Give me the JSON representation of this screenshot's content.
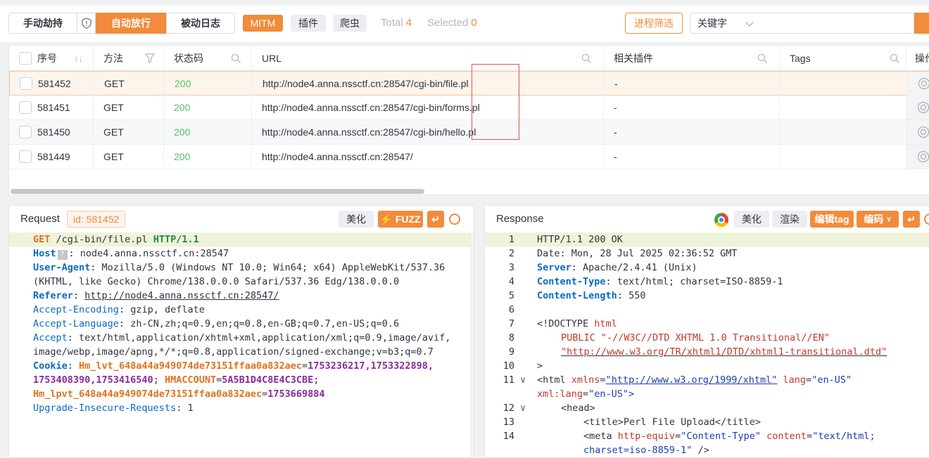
{
  "topbar": {
    "mode_manual": "手动劫持",
    "mode_auto": "自动放行",
    "mode_passive": "被动日志",
    "chip_mitm": "MITM",
    "chip_plugin": "插件",
    "chip_crawler": "爬虫",
    "total_label": "Total",
    "total_value": "4",
    "selected_label": "Selected",
    "selected_value": "0",
    "process_filter": "进程筛选",
    "keyword_select": "关键字",
    "search_placeholder": ""
  },
  "table": {
    "headers": {
      "seq": "序号",
      "method": "方法",
      "status": "状态码",
      "url": "URL",
      "plugins": "相关插件",
      "tags": "Tags",
      "ops": "操作"
    },
    "rows": [
      {
        "id": "581452",
        "method": "GET",
        "status": "200",
        "url": "http://node4.anna.nssctf.cn:28547/cgi-bin/file.pl",
        "plugins": "-",
        "tags": ""
      },
      {
        "id": "581451",
        "method": "GET",
        "status": "200",
        "url": "http://node4.anna.nssctf.cn:28547/cgi-bin/forms.pl",
        "plugins": "-",
        "tags": ""
      },
      {
        "id": "581450",
        "method": "GET",
        "status": "200",
        "url": "http://node4.anna.nssctf.cn:28547/cgi-bin/hello.pl",
        "plugins": "-",
        "tags": ""
      },
      {
        "id": "581449",
        "method": "GET",
        "status": "200",
        "url": "http://node4.anna.nssctf.cn:28547/",
        "plugins": "-",
        "tags": ""
      }
    ]
  },
  "request": {
    "title": "Request",
    "id_label": "id:",
    "id_value": "581452",
    "beautify": "美化",
    "fuzz": "FUZZ",
    "method": "GET",
    "path": "/cgi-bin/file.pl",
    "protocol": "HTTP/1.1",
    "host_key": "Host",
    "host_value": "node4.anna.nssctf.cn:28547",
    "ua_key": "User-Agent",
    "ua_value_1": "Mozilla/5.0 (Windows NT 10.0; Win64; x64) AppleWebKit/537.36",
    "ua_value_2": "(KHTML, like Gecko) Chrome/138.0.0.0 Safari/537.36 Edg/138.0.0.0",
    "referer_key": "Referer",
    "referer_value": "http://node4.anna.nssctf.cn:28547/",
    "ae_key": "Accept-Encoding",
    "ae_value": "gzip, deflate",
    "al_key": "Accept-Language",
    "al_value": "zh-CN,zh;q=0.9,en;q=0.8,en-GB;q=0.7,en-US;q=0.6",
    "accept_key": "Accept",
    "accept_value_1": "text/html,application/xhtml+xml,application/xml;q=0.9,image/avif,",
    "accept_value_2": "image/webp,image/apng,*/*;q=0.8,application/signed-exchange;v=b3;q=0.7",
    "cookie_key": "Cookie",
    "cookie_1_key": "Hm_lvt_648a44a949074de73151ffaa0a832aec",
    "cookie_1_val_a": "1753236217,1753322898,",
    "cookie_1_val_b": "1753408390,1753416540",
    "cookie_2_key": "HMACCOUNT",
    "cookie_2_val": "5A5B1D4C8E4C3CBE",
    "cookie_3_key": "Hm_lpvt_648a44a949074de73151ffaa0a832aec",
    "cookie_3_val": "1753669884",
    "uir_key": "Upgrade-Insecure-Requests",
    "uir_value": "1"
  },
  "response": {
    "title": "Response",
    "beautify": "美化",
    "render": "渲染",
    "edit_tag": "编辑tag",
    "encode": "编码",
    "status_line": "HTTP/1.1 200 OK",
    "date_line": "Date: Mon, 28 Jul 2025 02:36:52 GMT",
    "server_key": "Server",
    "server_value": "Apache/2.4.41 (Unix)",
    "ct_key": "Content-Type",
    "ct_value": "text/html; charset=ISO-8859-1",
    "cl_key": "Content-Length",
    "cl_value": "550",
    "doctype_1": "<!DOCTYPE",
    "doctype_html": "html",
    "doctype_2": "PUBLIC \"-//W3C//DTD XHTML 1.0 Transitional//EN\"",
    "doctype_3": "\"http://www.w3.org/TR/xhtml1/DTD/xhtml1-transitional.dtd\"",
    "doctype_4": ">",
    "html_open": "<html",
    "xmlns_attr": "xmlns",
    "xmlns_val": "\"http://www.w3.org/1999/xhtml\"",
    "lang_attr": "lang",
    "lang_val": "\"en-US\"",
    "xmllang_attr": "xml:lang",
    "xmllang_val": "\"en-US\">",
    "head_open": "<head>",
    "title_line": "<title>Perl File Upload</title>",
    "meta_open": "<meta",
    "http_equiv_attr": "http-equiv",
    "http_equiv_val": "\"Content-Type\"",
    "content_attr": "content",
    "content_val_1": "\"text/html;",
    "content_val_2": "charset=iso-8859-1\"",
    "meta_close": " />",
    "line_numbers": [
      "1",
      "2",
      "3",
      "4",
      "5",
      "6",
      "7",
      "8",
      "9",
      "10",
      "11",
      "12",
      "13",
      "14"
    ]
  }
}
